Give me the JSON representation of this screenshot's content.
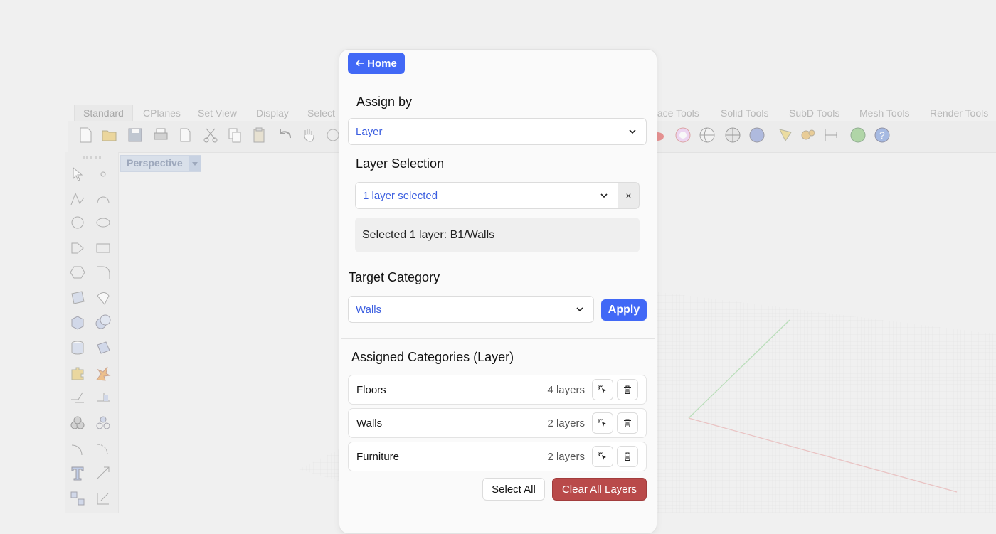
{
  "cad": {
    "toolbar_tabs": [
      "Standard",
      "CPlanes",
      "Set View",
      "Display",
      "Select",
      "face Tools",
      "Solid Tools",
      "SubD Tools",
      "Mesh Tools",
      "Render Tools"
    ],
    "viewport_tab": "Perspective"
  },
  "panel": {
    "home_label": "Home",
    "assign_by": {
      "title": "Assign by",
      "value": "Layer"
    },
    "layer_selection": {
      "title": "Layer Selection",
      "value": "1 layer selected",
      "clear_symbol": "×",
      "info": "Selected 1 layer: B1/Walls"
    },
    "target_category": {
      "title": "Target Category",
      "value": "Walls",
      "apply_label": "Apply"
    },
    "assigned": {
      "title": "Assigned Categories (Layer)",
      "rows": [
        {
          "name": "Floors",
          "count": "4 layers"
        },
        {
          "name": "Walls",
          "count": "2 layers"
        },
        {
          "name": "Furniture",
          "count": "2 layers"
        }
      ]
    },
    "select_all_label": "Select All",
    "clear_all_label": "Clear All Layers"
  },
  "colors": {
    "accent": "#4168f6",
    "danger": "#b94a4a",
    "link_text": "#3b5ee0"
  },
  "icons": [
    "back-arrow-icon",
    "chevron-down-icon",
    "cursor-select-icon",
    "trash-icon"
  ]
}
